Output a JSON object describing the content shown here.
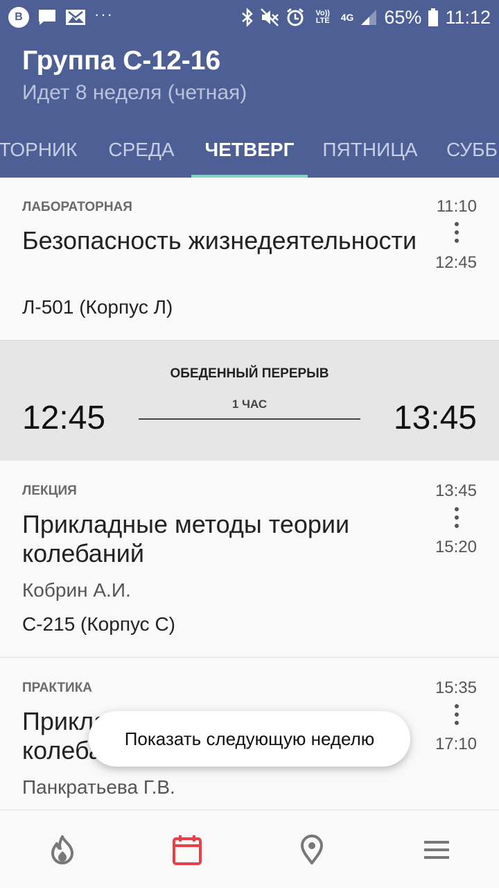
{
  "status_bar": {
    "app_badge": "В",
    "battery": "65%",
    "time": "11:12",
    "network": "4G",
    "volte": "Vo)) LTE"
  },
  "header": {
    "title": "Группа С-12-16",
    "subtitle": "Идет 8 неделя (четная)"
  },
  "tabs": [
    {
      "label": "ТОРНИК"
    },
    {
      "label": "СРЕДА"
    },
    {
      "label": "ЧЕТВЕРГ",
      "active": true
    },
    {
      "label": "ПЯТНИЦА"
    },
    {
      "label": "СУББ"
    }
  ],
  "lessons": [
    {
      "type": "ЛАБОРАТОРНАЯ",
      "subject": "Безопасность жизнедеятельности",
      "room": "Л-501 (Корпус Л)",
      "start": "11:10",
      "end": "12:45"
    },
    {
      "type": "ЛЕКЦИЯ",
      "subject": "Прикладные методы теории колебаний",
      "teacher": "Кобрин А.И.",
      "room": "С-215 (Корпус С)",
      "start": "13:45",
      "end": "15:20"
    },
    {
      "type": "ПРАКТИКА",
      "subject": "Прикладные методы теории колебаний",
      "teacher": "Панкратьева Г.В.",
      "start": "15:35",
      "end": "17:10"
    }
  ],
  "break": {
    "label": "ОБЕДЕННЫЙ ПЕРЕРЫВ",
    "duration": "1 ЧАС",
    "start": "12:45",
    "end": "13:45"
  },
  "snackbar": {
    "text": "Показать следующую неделю"
  },
  "bottom_nav": [
    {
      "icon": "fire-icon"
    },
    {
      "icon": "calendar-icon",
      "active": true
    },
    {
      "icon": "location-pin-icon"
    },
    {
      "icon": "menu-icon"
    }
  ],
  "colors": {
    "primary": "#4d5f94",
    "tab_indicator": "#7fd6c5",
    "nav_active": "#e8404a",
    "nav_inactive": "#777777"
  }
}
